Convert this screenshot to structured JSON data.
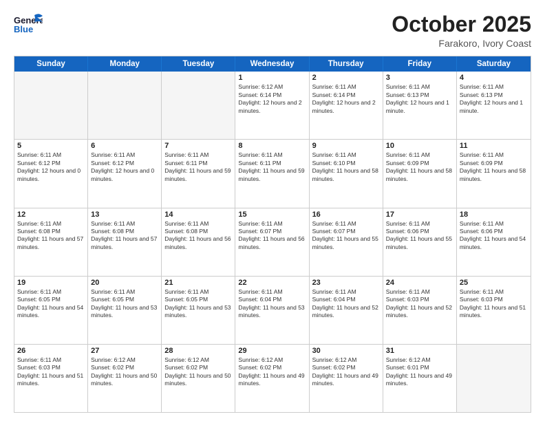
{
  "logo": {
    "general": "General",
    "blue": "Blue"
  },
  "title": "October 2025",
  "location": "Farakoro, Ivory Coast",
  "weekdays": [
    "Sunday",
    "Monday",
    "Tuesday",
    "Wednesday",
    "Thursday",
    "Friday",
    "Saturday"
  ],
  "rows": [
    [
      {
        "day": "",
        "empty": true
      },
      {
        "day": "",
        "empty": true
      },
      {
        "day": "",
        "empty": true
      },
      {
        "day": "1",
        "sunrise": "Sunrise: 6:12 AM",
        "sunset": "Sunset: 6:14 PM",
        "daylight": "Daylight: 12 hours and 2 minutes."
      },
      {
        "day": "2",
        "sunrise": "Sunrise: 6:11 AM",
        "sunset": "Sunset: 6:14 PM",
        "daylight": "Daylight: 12 hours and 2 minutes."
      },
      {
        "day": "3",
        "sunrise": "Sunrise: 6:11 AM",
        "sunset": "Sunset: 6:13 PM",
        "daylight": "Daylight: 12 hours and 1 minute."
      },
      {
        "day": "4",
        "sunrise": "Sunrise: 6:11 AM",
        "sunset": "Sunset: 6:13 PM",
        "daylight": "Daylight: 12 hours and 1 minute."
      }
    ],
    [
      {
        "day": "5",
        "sunrise": "Sunrise: 6:11 AM",
        "sunset": "Sunset: 6:12 PM",
        "daylight": "Daylight: 12 hours and 0 minutes."
      },
      {
        "day": "6",
        "sunrise": "Sunrise: 6:11 AM",
        "sunset": "Sunset: 6:12 PM",
        "daylight": "Daylight: 12 hours and 0 minutes."
      },
      {
        "day": "7",
        "sunrise": "Sunrise: 6:11 AM",
        "sunset": "Sunset: 6:11 PM",
        "daylight": "Daylight: 11 hours and 59 minutes."
      },
      {
        "day": "8",
        "sunrise": "Sunrise: 6:11 AM",
        "sunset": "Sunset: 6:11 PM",
        "daylight": "Daylight: 11 hours and 59 minutes."
      },
      {
        "day": "9",
        "sunrise": "Sunrise: 6:11 AM",
        "sunset": "Sunset: 6:10 PM",
        "daylight": "Daylight: 11 hours and 58 minutes."
      },
      {
        "day": "10",
        "sunrise": "Sunrise: 6:11 AM",
        "sunset": "Sunset: 6:09 PM",
        "daylight": "Daylight: 11 hours and 58 minutes."
      },
      {
        "day": "11",
        "sunrise": "Sunrise: 6:11 AM",
        "sunset": "Sunset: 6:09 PM",
        "daylight": "Daylight: 11 hours and 58 minutes."
      }
    ],
    [
      {
        "day": "12",
        "sunrise": "Sunrise: 6:11 AM",
        "sunset": "Sunset: 6:08 PM",
        "daylight": "Daylight: 11 hours and 57 minutes."
      },
      {
        "day": "13",
        "sunrise": "Sunrise: 6:11 AM",
        "sunset": "Sunset: 6:08 PM",
        "daylight": "Daylight: 11 hours and 57 minutes."
      },
      {
        "day": "14",
        "sunrise": "Sunrise: 6:11 AM",
        "sunset": "Sunset: 6:08 PM",
        "daylight": "Daylight: 11 hours and 56 minutes."
      },
      {
        "day": "15",
        "sunrise": "Sunrise: 6:11 AM",
        "sunset": "Sunset: 6:07 PM",
        "daylight": "Daylight: 11 hours and 56 minutes."
      },
      {
        "day": "16",
        "sunrise": "Sunrise: 6:11 AM",
        "sunset": "Sunset: 6:07 PM",
        "daylight": "Daylight: 11 hours and 55 minutes."
      },
      {
        "day": "17",
        "sunrise": "Sunrise: 6:11 AM",
        "sunset": "Sunset: 6:06 PM",
        "daylight": "Daylight: 11 hours and 55 minutes."
      },
      {
        "day": "18",
        "sunrise": "Sunrise: 6:11 AM",
        "sunset": "Sunset: 6:06 PM",
        "daylight": "Daylight: 11 hours and 54 minutes."
      }
    ],
    [
      {
        "day": "19",
        "sunrise": "Sunrise: 6:11 AM",
        "sunset": "Sunset: 6:05 PM",
        "daylight": "Daylight: 11 hours and 54 minutes."
      },
      {
        "day": "20",
        "sunrise": "Sunrise: 6:11 AM",
        "sunset": "Sunset: 6:05 PM",
        "daylight": "Daylight: 11 hours and 53 minutes."
      },
      {
        "day": "21",
        "sunrise": "Sunrise: 6:11 AM",
        "sunset": "Sunset: 6:05 PM",
        "daylight": "Daylight: 11 hours and 53 minutes."
      },
      {
        "day": "22",
        "sunrise": "Sunrise: 6:11 AM",
        "sunset": "Sunset: 6:04 PM",
        "daylight": "Daylight: 11 hours and 53 minutes."
      },
      {
        "day": "23",
        "sunrise": "Sunrise: 6:11 AM",
        "sunset": "Sunset: 6:04 PM",
        "daylight": "Daylight: 11 hours and 52 minutes."
      },
      {
        "day": "24",
        "sunrise": "Sunrise: 6:11 AM",
        "sunset": "Sunset: 6:03 PM",
        "daylight": "Daylight: 11 hours and 52 minutes."
      },
      {
        "day": "25",
        "sunrise": "Sunrise: 6:11 AM",
        "sunset": "Sunset: 6:03 PM",
        "daylight": "Daylight: 11 hours and 51 minutes."
      }
    ],
    [
      {
        "day": "26",
        "sunrise": "Sunrise: 6:11 AM",
        "sunset": "Sunset: 6:03 PM",
        "daylight": "Daylight: 11 hours and 51 minutes."
      },
      {
        "day": "27",
        "sunrise": "Sunrise: 6:12 AM",
        "sunset": "Sunset: 6:02 PM",
        "daylight": "Daylight: 11 hours and 50 minutes."
      },
      {
        "day": "28",
        "sunrise": "Sunrise: 6:12 AM",
        "sunset": "Sunset: 6:02 PM",
        "daylight": "Daylight: 11 hours and 50 minutes."
      },
      {
        "day": "29",
        "sunrise": "Sunrise: 6:12 AM",
        "sunset": "Sunset: 6:02 PM",
        "daylight": "Daylight: 11 hours and 49 minutes."
      },
      {
        "day": "30",
        "sunrise": "Sunrise: 6:12 AM",
        "sunset": "Sunset: 6:02 PM",
        "daylight": "Daylight: 11 hours and 49 minutes."
      },
      {
        "day": "31",
        "sunrise": "Sunrise: 6:12 AM",
        "sunset": "Sunset: 6:01 PM",
        "daylight": "Daylight: 11 hours and 49 minutes."
      },
      {
        "day": "",
        "empty": true
      }
    ]
  ]
}
